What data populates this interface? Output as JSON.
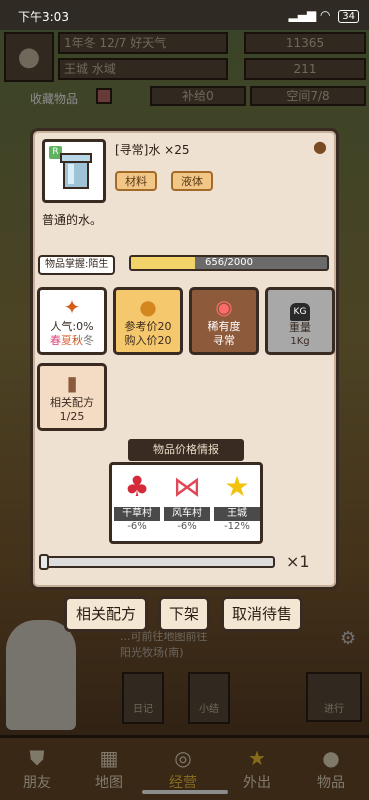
{
  "status": {
    "time": "下午3:03",
    "battery": "34"
  },
  "hud": {
    "date": "1年冬 12/7 好天气",
    "money": "11365",
    "location": "王城 水域",
    "count": "211",
    "collect_label": "收藏物品",
    "supply": "补给0",
    "space": "空间7/8"
  },
  "bg_notice": {
    "line1": "...可前往地图前往",
    "line2": "阳光牧场(南)"
  },
  "bg_buttons": {
    "diary": "日记",
    "tips": "小结",
    "proceed": "进行"
  },
  "item": {
    "title": "[寻常]水 ×25",
    "tags": [
      "材料",
      "液体"
    ],
    "description": "普通的水。",
    "rarity_badge": "R"
  },
  "mastery": {
    "label": "物品掌握:陌生",
    "text": "656/2000",
    "progress": 0.328
  },
  "cards": {
    "popularity": {
      "line1": "人气:0%",
      "season_spring": "春",
      "season_summer": "夏",
      "season_autumn": "秋",
      "season_winter": "冬"
    },
    "price": {
      "line1": "参考价20",
      "line2": "购入价20"
    },
    "rarity": {
      "line1": "稀有度",
      "line2": "寻常"
    },
    "weight": {
      "line1": "重量",
      "line2": "1Kg",
      "icon_text": "KG"
    },
    "recipe": {
      "line1": "相关配方",
      "line2": "1/25"
    }
  },
  "market": {
    "title": "物品价格情报",
    "towns": [
      {
        "name": "干草村",
        "change": "-6%"
      },
      {
        "name": "风车村",
        "change": "-6%"
      },
      {
        "name": "王城",
        "change": "-12%"
      }
    ]
  },
  "quantity": "×1",
  "actions": {
    "recipes": "相关配方",
    "unlist": "下架",
    "cancel_sale": "取消待售"
  },
  "nav": [
    "朋友",
    "地图",
    "经营",
    "外出",
    "物品"
  ],
  "colors": {
    "accent": "#f2d36a",
    "panel": "#eee1d2",
    "border": "#3a2b22"
  }
}
